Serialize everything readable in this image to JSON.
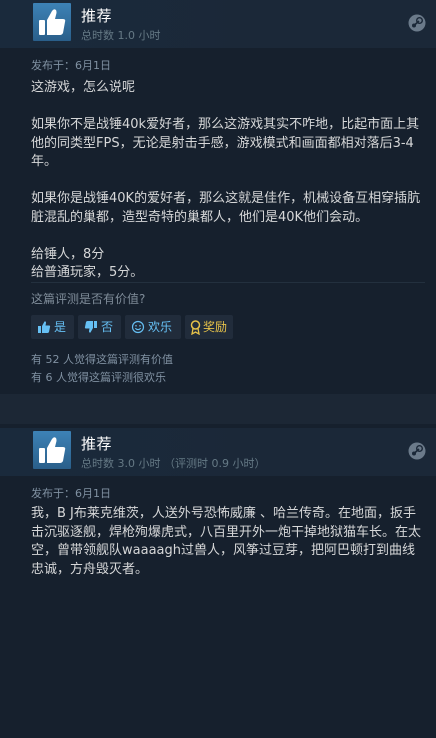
{
  "reviews": [
    {
      "verdict": "推荐",
      "hours": "总时数 1.0 小时",
      "posted": "发布于：6月1日",
      "paragraphs": [
        "这游戏，怎么说呢",
        "如果你不是战锤40k爱好者，那么这游戏其实不咋地，比起市面上其他的同类型FPS，无论是射击手感，游戏模式和画面都相对落后3-4年。",
        "如果你是战锤40K的爱好者，那么这就是佳作，机械设备互相穿插肮脏混乱的巢都，造型奇特的巢都人，他们是40K他们会动。",
        "给锤人，8分\n给普通玩家，5分。"
      ],
      "helpful_question": "这篇评测是否有价值?",
      "buttons": {
        "yes": "是",
        "no": "否",
        "funny": "欢乐",
        "award": "奖励"
      },
      "helpful_count": "有 52 人觉得这篇评测有价值",
      "funny_count": "有 6 人觉得这篇评测很欢乐"
    },
    {
      "verdict": "推荐",
      "hours": "总时数 3.0 小时 （评测时 0.9 小时）",
      "posted": "发布于：6月1日",
      "paragraphs": [
        "我，B J布莱克维茨，人送外号恐怖威廉 、哈兰传奇。在地面，扳手击沉驱逐舰，焊枪殉爆虎式，八百里开外一炮干掉地狱猫车长。在太空，曾带领舰队waaaagh过兽人，风筝过豆芽，把阿巴顿打到曲线忠诚，方舟毁灭者。"
      ]
    }
  ],
  "icons": {
    "thumbs": "thumbs-up-icon",
    "platform": "steam-icon",
    "yes": "thumbs-up-icon",
    "no": "thumbs-down-icon",
    "funny": "smiley-icon",
    "award": "award-icon"
  },
  "colors": {
    "background": "#16202d",
    "header": "#1b2838",
    "accent": "#66c0f4",
    "thumb_bg": "#3d82b6"
  }
}
